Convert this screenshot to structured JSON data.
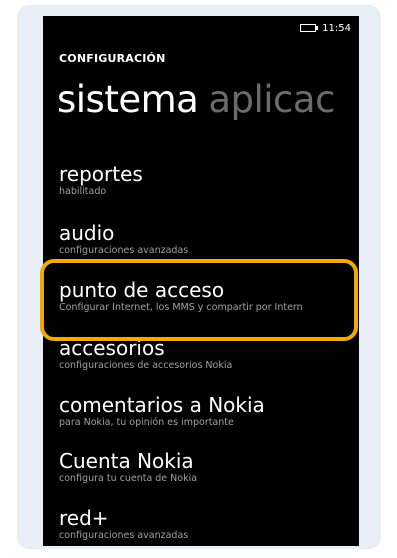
{
  "status_bar": {
    "battery_icon": "battery-icon",
    "time": "11:54"
  },
  "header": {
    "section_title": "CONFIGURACIÓN",
    "pivot_active": "sistema",
    "pivot_next": "aplicac"
  },
  "items": [
    {
      "title": "reportes",
      "subtitle": "habilitado"
    },
    {
      "title": "audio",
      "subtitle": "configuraciones avanzadas"
    },
    {
      "title": "punto de acceso",
      "subtitle": "Configurar Internet, los MMS y compartir por Intern"
    },
    {
      "title": "accesorios",
      "subtitle": "configuraciones de accesorios Nokia"
    },
    {
      "title": "comentarios a Nokia",
      "subtitle": "para Nokia, tu opinión es importante"
    },
    {
      "title": "Cuenta Nokia",
      "subtitle": "configura tu cuenta de Nokia"
    },
    {
      "title": "red+",
      "subtitle": "configuraciones avanzadas"
    }
  ],
  "highlight": {
    "color": "#f2a900",
    "target": "punto de acceso"
  }
}
